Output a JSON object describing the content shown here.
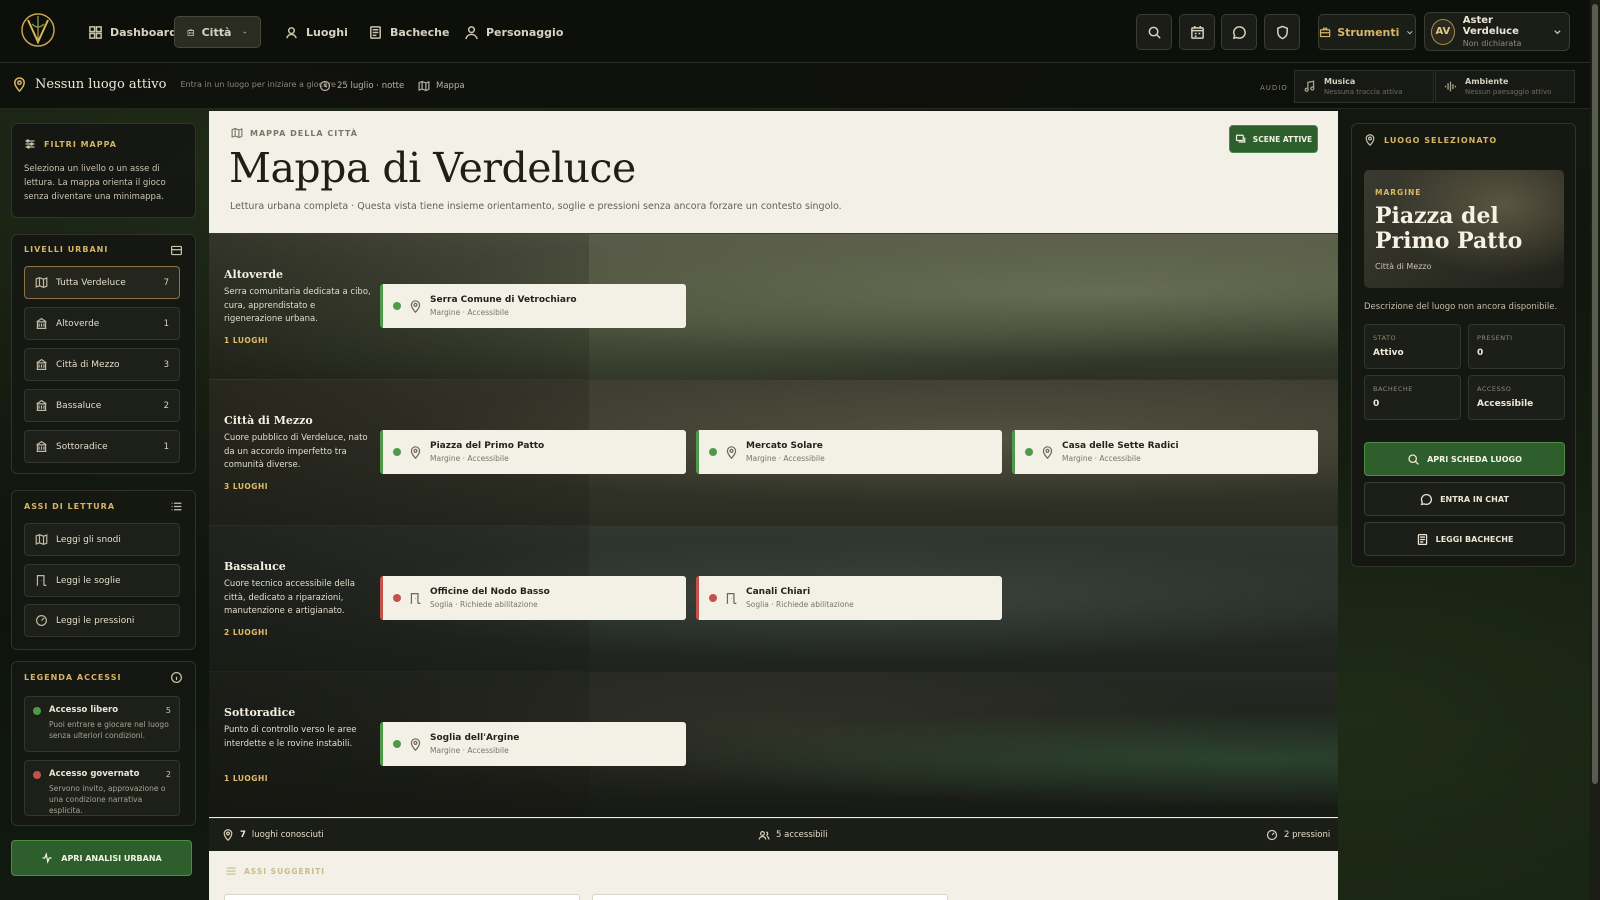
{
  "nav": {
    "items": [
      {
        "label": "Dashboard",
        "icon": "dashboard-icon"
      },
      {
        "label": "Città",
        "icon": "city-icon",
        "active": true
      },
      {
        "label": "Luoghi",
        "icon": "places-icon"
      },
      {
        "label": "Bacheche",
        "icon": "boards-icon"
      },
      {
        "label": "Personaggio",
        "icon": "character-icon"
      }
    ],
    "tools_label": "Strumenti",
    "user": {
      "initials": "AV",
      "name": "Aster Verdeluce",
      "status": "Non dichiarata"
    }
  },
  "status": {
    "location": "Nessun luogo attivo",
    "hint": "Entra in un luogo per iniziare a giocare",
    "time": "25 luglio · notte",
    "map": "Mappa",
    "audio_label": "AUDIO",
    "music_title": "Musica",
    "music_sub": "Nessuna traccia attiva",
    "ambient_title": "Ambiente",
    "ambient_sub": "Nessun paesaggio attivo"
  },
  "sidebar": {
    "filters_title": "FILTRI MAPPA",
    "filters_desc": "Seleziona un livello o un asse di lettura. La mappa orienta il gioco senza diventare una minimappa.",
    "levels_title": "LIVELLI URBANI",
    "levels": [
      {
        "label": "Tutta Verdeluce",
        "count": "7",
        "active": true
      },
      {
        "label": "Altoverde",
        "count": "1"
      },
      {
        "label": "Città di Mezzo",
        "count": "3"
      },
      {
        "label": "Bassaluce",
        "count": "2"
      },
      {
        "label": "Sottoradice",
        "count": "1"
      }
    ],
    "axes_title": "ASSI DI LETTURA",
    "axes": [
      {
        "label": "Leggi gli snodi"
      },
      {
        "label": "Leggi le soglie"
      },
      {
        "label": "Leggi le pressioni"
      }
    ],
    "legend_title": "LEGENDA ACCESSI",
    "legend": [
      {
        "title": "Accesso libero",
        "count": "5",
        "desc": "Puoi entrare e giocare nel luogo senza ulteriori condizioni.",
        "color": "#4f9a4a"
      },
      {
        "title": "Accesso governato",
        "count": "2",
        "desc": "Servono invito, approvazione o una condizione narrativa esplicita.",
        "color": "#c5524a"
      }
    ],
    "analysis_button": "APRI ANALISI URBANA"
  },
  "main": {
    "eyebrow": "MAPPA DELLA CITTÀ",
    "title": "Mappa di Verdeluce",
    "subtitle": "Lettura urbana completa · Questa vista tiene insieme orientamento, soglie e pressioni senza ancora forzare un contesto singolo.",
    "scenes_button": "SCENE ATTIVE",
    "bands": [
      {
        "name": "Altoverde",
        "desc": "Serra comunitaria dedicata a cibo, cura, apprendistato e rigenerazione urbana.",
        "count": "1 LUOGHI",
        "places": [
          {
            "name": "Serra Comune di Vetrochiaro",
            "meta": "Margine · Accessibile",
            "type": "margine"
          }
        ]
      },
      {
        "name": "Città di Mezzo",
        "desc": "Cuore pubblico di Verdeluce, nato da un accordo imperfetto tra comunità diverse.",
        "count": "3 LUOGHI",
        "places": [
          {
            "name": "Piazza del Primo Patto",
            "meta": "Margine · Accessibile",
            "type": "margine"
          },
          {
            "name": "Mercato Solare",
            "meta": "Margine · Accessibile",
            "type": "margine"
          },
          {
            "name": "Casa delle Sette Radici",
            "meta": "Margine · Accessibile",
            "type": "margine"
          }
        ]
      },
      {
        "name": "Bassaluce",
        "desc": "Cuore tecnico accessibile della città, dedicato a riparazioni, manutenzione e artigianato.",
        "count": "2 LUOGHI",
        "places": [
          {
            "name": "Officine del Nodo Basso",
            "meta": "Soglia · Richiede abilitazione",
            "type": "soglia"
          },
          {
            "name": "Canali Chiari",
            "meta": "Soglia · Richiede abilitazione",
            "type": "soglia"
          }
        ]
      },
      {
        "name": "Sottoradice",
        "desc": "Punto di controllo verso le aree interdette e le rovine instabili.",
        "count": "1 LUOGHI",
        "places": [
          {
            "name": "Soglia dell'Argine",
            "meta": "Margine · Accessibile",
            "type": "margine"
          }
        ]
      }
    ],
    "stats": {
      "known_count": "7",
      "known_label": "luoghi conosciuti",
      "accessible": "5 accessibili",
      "pressures": "2 pressioni"
    },
    "suggested_title": "ASSI SUGGERITI"
  },
  "selected": {
    "panel_title": "LUOGO SELEZIONATO",
    "eyebrow": "MARGINE",
    "name": "Piazza del Primo Patto",
    "district": "Città di Mezzo",
    "desc": "Descrizione del luogo non ancora disponibile.",
    "info": [
      {
        "label": "STATO",
        "value": "Attivo"
      },
      {
        "label": "PRESENTI",
        "value": "0"
      },
      {
        "label": "BACHECHE",
        "value": "0"
      },
      {
        "label": "ACCESSO",
        "value": "Accessibile"
      }
    ],
    "btn_open": "APRI SCHEDA LUOGO",
    "btn_chat": "ENTRA IN CHAT",
    "btn_boards": "LEGGI BACHECHE"
  },
  "colors": {
    "accent_green": "#2f5e2d",
    "gold": "#d6b463",
    "free": "#4f9a4a",
    "governed": "#c5524a"
  }
}
